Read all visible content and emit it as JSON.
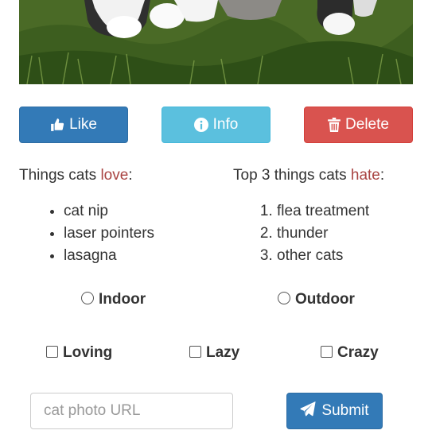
{
  "photo": {
    "alt_subject": "cat on grass",
    "icon": "cat-photo"
  },
  "buttons": {
    "like": {
      "label": "Like",
      "icon": "thumbs-up-icon"
    },
    "info": {
      "label": "Info",
      "icon": "info-circle-icon"
    },
    "delete": {
      "label": "Delete",
      "icon": "trash-icon"
    }
  },
  "love": {
    "title_prefix": "Things cats ",
    "title_accent": "love",
    "title_suffix": ":",
    "items": [
      "cat nip",
      "laser pointers",
      "lasagna"
    ]
  },
  "hate": {
    "title_prefix": "Top 3 things cats ",
    "title_accent": "hate",
    "title_suffix": ":",
    "items": [
      "flea treatment",
      "thunder",
      "other cats"
    ]
  },
  "radios": {
    "indoor": "Indoor",
    "outdoor": "Outdoor"
  },
  "checkboxes": {
    "loving": "Loving",
    "lazy": "Lazy",
    "crazy": "Crazy"
  },
  "form": {
    "url_placeholder": "cat photo URL",
    "submit_label": "Submit",
    "submit_icon": "paper-plane-icon"
  },
  "colors": {
    "primary": "#337ab7",
    "info": "#5bc0de",
    "danger": "#d9534f",
    "accent_text": "#a94442"
  }
}
